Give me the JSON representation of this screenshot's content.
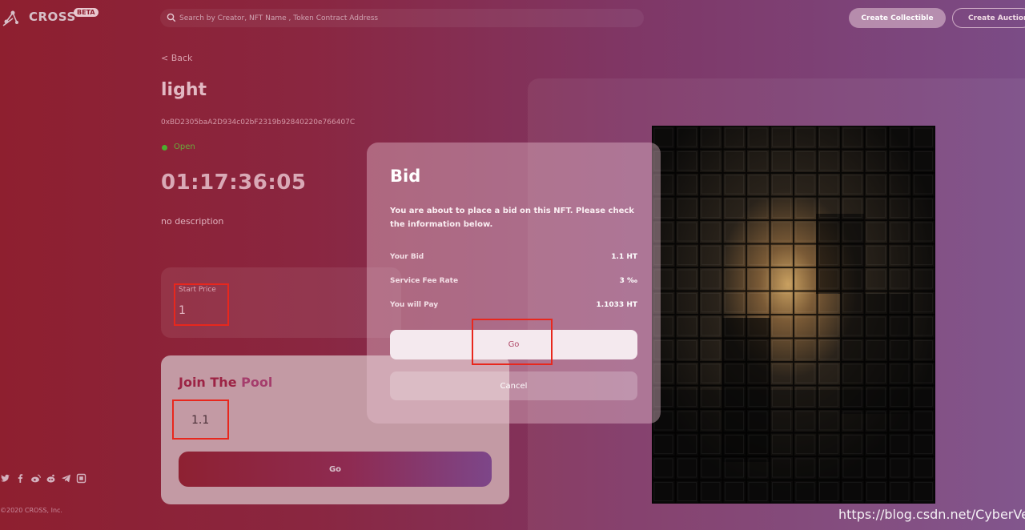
{
  "header": {
    "logo_text": "CROSS",
    "beta_badge": "BETA",
    "search_placeholder": "Search by Creator, NFT Name , Token Contract Address",
    "create_collectible_label": "Create Collectible",
    "create_auction_label": "Create Auction"
  },
  "nft": {
    "back_label": "< Back",
    "name": "light",
    "contract_address": "0xBD2305baA2D934c02bF2319b92840220e766407C",
    "status": "Open",
    "countdown": "01:17:36:05",
    "description": "no description"
  },
  "start_price": {
    "label": "Start Price",
    "value": "1"
  },
  "pool": {
    "title_part1": "Join The ",
    "title_part2": "Pool",
    "input_value": "1.1",
    "go_label": "Go"
  },
  "footer": {
    "social_icons": [
      "twitter-icon",
      "facebook-icon",
      "weibo-icon",
      "weibo-alt-icon",
      "telegram-icon",
      "coinmarket-icon"
    ],
    "copyright": "©2020 CROSS, Inc."
  },
  "modal": {
    "title": "Bid",
    "message": "You are about to place a bid on this NFT. Please check the information below.",
    "rows": [
      {
        "label": "Your Bid",
        "value": "1.1 HT"
      },
      {
        "label": "Service Fee Rate",
        "value": "3 ‰"
      },
      {
        "label": "You will Pay",
        "value": "1.1033 HT"
      }
    ],
    "go_label": "Go",
    "cancel_label": "Cancel"
  },
  "watermark": "https://blog.csdn.net/CyberVein",
  "colors": {
    "highlight_box": "#e8271d",
    "status_green": "#4caf2e",
    "accent_red": "#8e1f2f",
    "accent_purple": "#7b4c86"
  }
}
